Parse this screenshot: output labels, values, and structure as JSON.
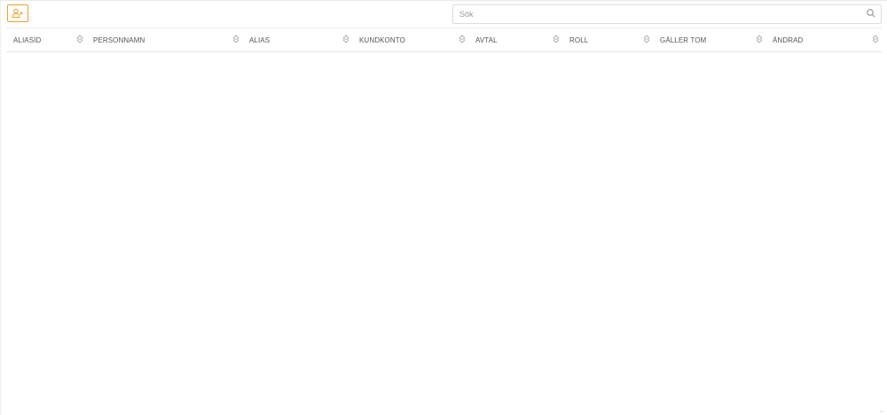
{
  "toolbar": {
    "add_button_icon": "add-user-icon",
    "search": {
      "placeholder": "Sök",
      "value": "",
      "icon": "search-icon"
    }
  },
  "table": {
    "columns": [
      {
        "label": "ALIASID",
        "sort_icon": "sort-icon"
      },
      {
        "label": "PERSONNAMN",
        "sort_icon": "sort-icon"
      },
      {
        "label": "ALIAS",
        "sort_icon": "sort-icon"
      },
      {
        "label": "KUNDKONTO",
        "sort_icon": "sort-icon"
      },
      {
        "label": "AVTAL",
        "sort_icon": "sort-icon"
      },
      {
        "label": "ROLL",
        "sort_icon": "sort-icon"
      },
      {
        "label": "GÄLLER TOM",
        "sort_icon": "sort-icon"
      },
      {
        "label": "ÄNDRAD",
        "sort_icon": "sort-icon"
      }
    ],
    "rows": []
  },
  "colors": {
    "accent": "#f0a030",
    "border": "#dcdcdc",
    "header_text": "#555555",
    "icon": "#a0a0a0"
  }
}
